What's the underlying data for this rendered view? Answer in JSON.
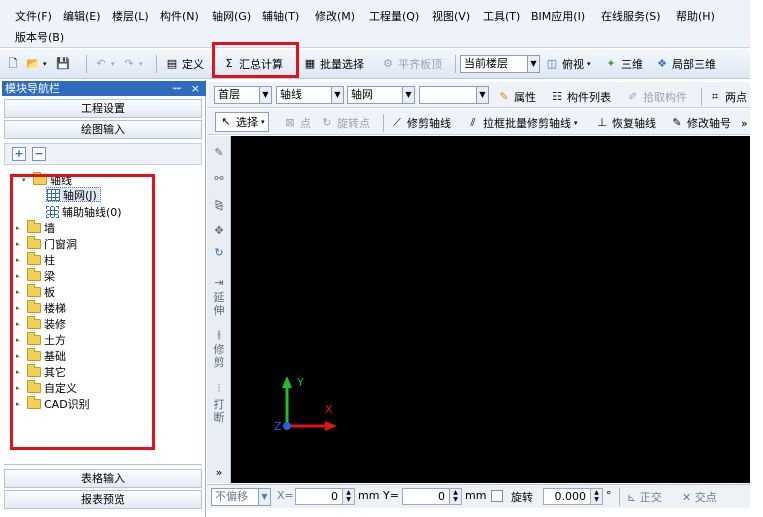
{
  "menu": {
    "row1": [
      "文件(F)",
      "编辑(E)",
      "楼层(L)",
      "构件(N)",
      "轴网(G)",
      "辅轴(T)",
      "修改(M)",
      "工程量(Q)",
      "视图(V)",
      "工具(T)",
      "BIM应用(I)",
      "在线服务(S)",
      "帮助(H)"
    ],
    "row2": [
      "版本号(B)"
    ]
  },
  "toolbar": {
    "define": "定义",
    "sum_calc": "汇总计算",
    "batch_select": "批量选择",
    "flush_top": "平齐板顶",
    "current_floor": "当前楼层",
    "top_view": "俯视",
    "three_d": "三维",
    "local_3d": "局部三维"
  },
  "combos": {
    "floor": "首层",
    "type1": "轴线",
    "type2": "轴网",
    "empty": ""
  },
  "props_bar": {
    "properties": "属性",
    "component_list": "构件列表",
    "pick_component": "拾取构件",
    "two_point": "两点"
  },
  "draw_bar": {
    "select": "选择",
    "point": "点",
    "rotate_point": "旋转点",
    "trim_axis": "修剪轴线",
    "batch_trim": "拉框批量修剪轴线",
    "restore_axis": "恢复轴线",
    "modify_axis_no": "修改轴号",
    "more": "»"
  },
  "left_panel": {
    "title": "模块导航栏",
    "pin": "ᅲ",
    "close": "×",
    "project_settings": "工程设置",
    "drawing_input": "绘图输入",
    "add": "+",
    "remove": "−",
    "table_input": "表格输入",
    "report_preview": "报表预览",
    "tree": {
      "root": "轴线",
      "children": [
        "轴网(J)",
        "辅助轴线(0)"
      ],
      "folders": [
        "墙",
        "门窗洞",
        "柱",
        "梁",
        "板",
        "楼梯",
        "装修",
        "土方",
        "基础",
        "其它",
        "自定义",
        "CAD识别"
      ]
    }
  },
  "vertical_tools": {
    "extend": [
      "延",
      "伸"
    ],
    "trim": [
      "修",
      "剪"
    ],
    "break": [
      "打",
      "断"
    ]
  },
  "canvas": {
    "axis_x": "X",
    "axis_y": "Y",
    "axis_z": "Z"
  },
  "status": {
    "no_offset": "不偏移",
    "x_label": "X=",
    "x_value": "0",
    "mm1": "mm",
    "y_label": "Y=",
    "y_value": "0",
    "mm2": "mm",
    "rotate": "旋转",
    "rotate_value": "0.000",
    "degree": "°",
    "ortho": "正交",
    "intersect": "交点"
  },
  "colors": {
    "highlight": "#e0131b",
    "panel_title": "#2f6cc0",
    "canvas": "#000000"
  }
}
